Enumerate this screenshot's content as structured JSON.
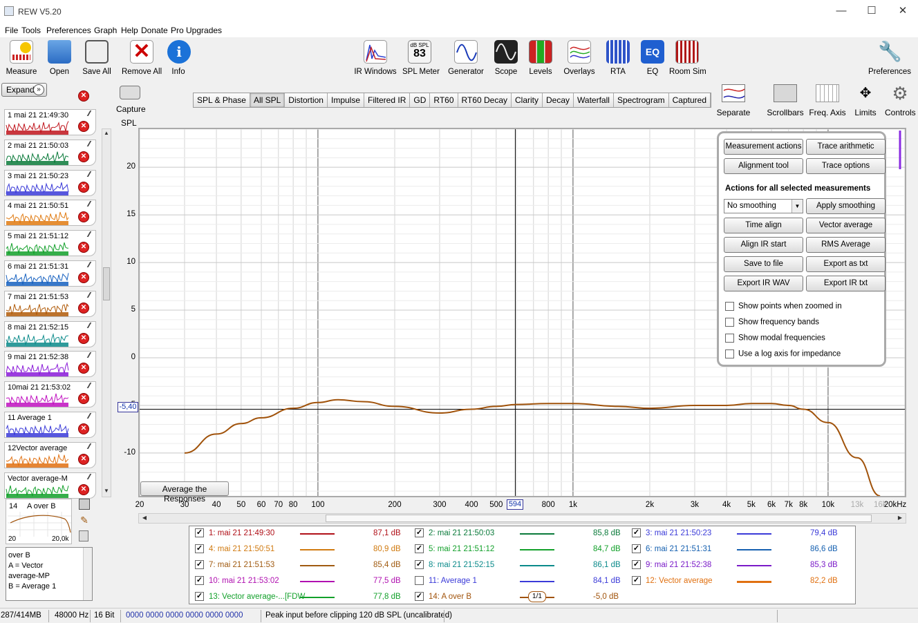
{
  "window": {
    "title": "REW V5.20"
  },
  "menu": [
    "File",
    "Tools",
    "Preferences",
    "Graph",
    "Help",
    "Donate",
    "Pro Upgrades"
  ],
  "toolbar": {
    "left": [
      "Measure",
      "Open",
      "Save All",
      "Remove All",
      "Info"
    ],
    "center": [
      "IR Windows",
      "SPL Meter",
      "Generator",
      "Scope",
      "Levels",
      "Overlays",
      "RTA",
      "EQ",
      "Room Sim"
    ],
    "spl_meter_unit": "dB SPL",
    "spl_meter_value": "83",
    "eq_icon_text": "EQ",
    "preferences": "Preferences"
  },
  "sidebar": {
    "expand_label": "Expand",
    "measurements": [
      {
        "label": "1 mai 21 21:49:30",
        "color": "#c0141c"
      },
      {
        "label": "2 mai 21 21:50:03",
        "color": "#0a7a3a"
      },
      {
        "label": "3 mai 21 21:50:23",
        "color": "#3a3ad8"
      },
      {
        "label": "4 mai 21 21:50:51",
        "color": "#e07a10"
      },
      {
        "label": "5 mai 21 21:51:12",
        "color": "#12a02a"
      },
      {
        "label": "6 mai 21 21:51:31",
        "color": "#1560c0"
      },
      {
        "label": "7 mai 21 21:51:53",
        "color": "#b05a08"
      },
      {
        "label": "8 mai 21 21:52:15",
        "color": "#0a8a8a"
      },
      {
        "label": "9 mai 21 21:52:38",
        "color": "#8a1ad8"
      },
      {
        "label": "10mai 21 21:53:02",
        "color": "#c010c0"
      },
      {
        "label": "11    Average 1",
        "color": "#3a3ad8"
      },
      {
        "label": "12Vector average",
        "color": "#e07010"
      },
      {
        "label": "Vector average-M",
        "color": "#12a02a"
      }
    ],
    "selected": {
      "label": "14",
      "name": "A over B",
      "min": "20",
      "max": "20,0k"
    },
    "info_lines": [
      "over B",
      "A = Vector",
      "average-MP",
      "B = Average 1"
    ]
  },
  "graph_toolbar": {
    "capture": "Capture",
    "tabs": [
      "SPL & Phase",
      "All SPL",
      "Distortion",
      "Impulse",
      "Filtered IR",
      "GD",
      "RT60",
      "RT60 Decay",
      "Clarity",
      "Decay",
      "Waterfall",
      "Spectrogram",
      "Captured"
    ],
    "active_tab": "All SPL",
    "right_tools": [
      "Separate",
      "Scrollbars",
      "Freq. Axis",
      "Limits",
      "Controls"
    ]
  },
  "graph": {
    "y_axis_title": "SPL",
    "y_ticks": [
      "20",
      "15",
      "10",
      "5",
      "0",
      "-5",
      "-10"
    ],
    "x_ticks": [
      "20",
      "30",
      "40",
      "50",
      "60",
      "70",
      "80",
      "100",
      "200",
      "300",
      "400",
      "500",
      "800",
      "1k",
      "2k",
      "3k",
      "4k",
      "5k",
      "6k",
      "7k",
      "8k",
      "10k",
      "13k",
      "16k",
      "20kHz"
    ],
    "cursor_y": "-5,40",
    "cursor_x": "594",
    "avg_button": "Average the Responses",
    "trace_color": "#a0520a"
  },
  "chart_data": {
    "type": "line",
    "title": "",
    "xlabel": "",
    "ylabel": "SPL",
    "x_scale": "log",
    "xlim": [
      20,
      20000
    ],
    "ylim": [
      -14.5,
      24
    ],
    "series": [
      {
        "name": "14: A over B",
        "x": [
          30,
          40,
          50,
          60,
          80,
          100,
          120,
          150,
          200,
          300,
          400,
          500,
          600,
          800,
          1000,
          1500,
          2000,
          3000,
          4000,
          5000,
          6000,
          7000,
          8000,
          10000,
          13000,
          16000
        ],
        "y": [
          -10.0,
          -8.0,
          -6.9,
          -6.3,
          -5.3,
          -4.7,
          -4.4,
          -4.6,
          -5.1,
          -5.8,
          -5.4,
          -5.1,
          -4.9,
          -4.8,
          -4.8,
          -5.1,
          -5.3,
          -5.0,
          -5.0,
          -4.8,
          -4.8,
          -5.0,
          -5.4,
          -6.8,
          -10.5,
          -14.5
        ]
      }
    ]
  },
  "controls": {
    "buttons_top": [
      "Measurement actions",
      "Trace arithmetic",
      "Alignment tool",
      "Trace options"
    ],
    "section_title": "Actions for all selected measurements",
    "smoothing_value": "No  smoothing",
    "buttons": [
      "Apply smoothing",
      "Time align",
      "Vector average",
      "Align IR start",
      "RMS Average",
      "Save to file",
      "Export as txt",
      "Export IR WAV",
      "Export IR txt"
    ],
    "checkboxes": [
      "Show points when zoomed in",
      "Show frequency bands",
      "Show modal frequencies",
      "Use a log axis for impedance"
    ]
  },
  "legend": [
    {
      "name": "1: mai 21 21:49:30",
      "value": "87,1 dB",
      "color": "#b01018",
      "checked": true
    },
    {
      "name": "2: mai 21 21:50:03",
      "value": "85,8 dB",
      "color": "#0a7a3a",
      "checked": true
    },
    {
      "name": "3: mai 21 21:50:23",
      "value": "79,4 dB",
      "color": "#3a3ad8",
      "checked": true
    },
    {
      "name": "4: mai 21 21:50:51",
      "value": "80,9 dB",
      "color": "#d07a10",
      "checked": true
    },
    {
      "name": "5: mai 21 21:51:12",
      "value": "84,7 dB",
      "color": "#12a02a",
      "checked": true
    },
    {
      "name": "6: mai 21 21:51:31",
      "value": "86,6 dB",
      "color": "#1560b0",
      "checked": true
    },
    {
      "name": "7: mai 21 21:51:53",
      "value": "85,4 dB",
      "color": "#a05a10",
      "checked": true
    },
    {
      "name": "8: mai 21 21:52:15",
      "value": "86,1 dB",
      "color": "#0a8a8a",
      "checked": true
    },
    {
      "name": "9: mai 21 21:52:38",
      "value": "85,3 dB",
      "color": "#7a1ac8",
      "checked": true
    },
    {
      "name": "10: mai 21 21:53:02",
      "value": "77,5 dB",
      "color": "#b010b0",
      "checked": true
    },
    {
      "name": "11: Average 1",
      "value": "84,1 dB",
      "color": "#3a3ad8",
      "checked": false
    },
    {
      "name": "12: Vector average",
      "value": "82,2 dB",
      "color": "#e07010",
      "checked": true
    },
    {
      "name": "13: Vector average-...[FDW",
      "value": "77,8 dB",
      "color": "#12a02a",
      "checked": true
    },
    {
      "name": "14: A over B",
      "value": "-5,0 dB",
      "color": "#a0520a",
      "checked": true,
      "badge": "1/1"
    }
  ],
  "status": {
    "memory": "287/414MB",
    "rate": "48000 Hz",
    "bits": "16 Bit",
    "levels": "0000 0000   0000 0000   0000 0000",
    "message": "Peak input before clipping 120 dB SPL (uncalibrated)"
  }
}
